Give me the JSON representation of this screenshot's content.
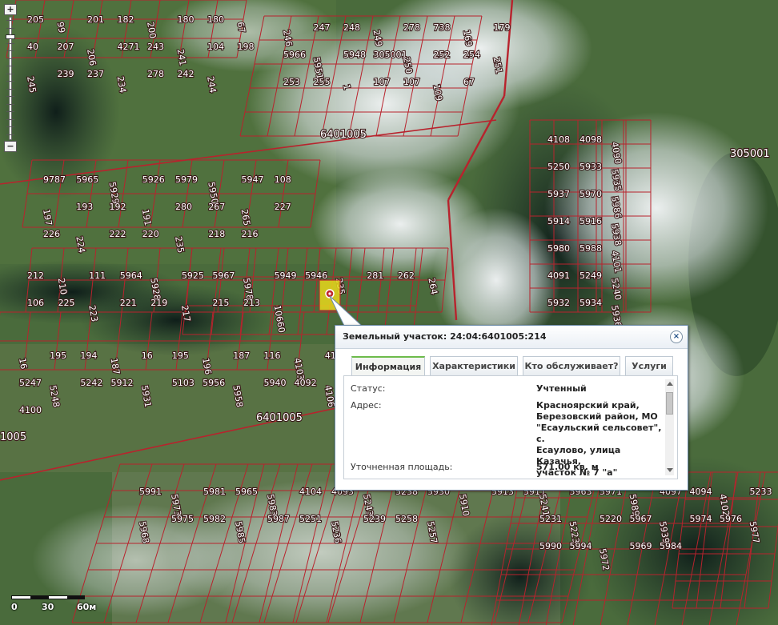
{
  "popup": {
    "title": "Земельный участок: 24:04:6401005:214",
    "close_glyph": "×",
    "tabs": [
      {
        "label": "Информация",
        "active": true
      },
      {
        "label": "Характеристики",
        "active": false
      },
      {
        "label": "Кто обслуживает?",
        "active": false
      },
      {
        "label": "Услуги",
        "active": false
      }
    ],
    "info": {
      "status_label": "Статус:",
      "status_value": "Учтенный",
      "address_label": "Адрес:",
      "address_lines": [
        "Красноярский край,",
        "Березовский район, МО",
        "\"Есаульский сельсовет\", с.",
        "Есаулово, улица Казачья,",
        "участок № 7 \"а\""
      ],
      "area_label": "Уточненная площадь:",
      "area_value": "571.00 кв. м"
    }
  },
  "zoom": {
    "plus": "+",
    "minus": "−",
    "level_fraction": 0.15
  },
  "scale": {
    "labels": [
      "0",
      "30",
      "60м"
    ]
  },
  "map": {
    "block_labels": [
      "6401005",
      "6401005",
      "305001",
      "1005"
    ],
    "plot_labels": [
      "205",
      "99",
      "201",
      "182",
      "200",
      "180",
      "180",
      "67",
      "40",
      "207",
      "206",
      "4271",
      "243",
      "241",
      "104",
      "198",
      "245",
      "239",
      "237",
      "234",
      "278",
      "242",
      "244",
      "246",
      "247",
      "248",
      "249",
      "278",
      "738",
      "169",
      "179",
      "5966",
      "5951",
      "5948",
      "305001",
      "250",
      "252",
      "254",
      "251",
      "253",
      "255",
      "1",
      "107",
      "107",
      "109",
      "67",
      "9787",
      "5965",
      "5929",
      "5926",
      "5979",
      "5950",
      "5947",
      "108",
      "197",
      "193",
      "192",
      "191",
      "280",
      "267",
      "265",
      "227",
      "226",
      "224",
      "222",
      "220",
      "235",
      "218",
      "216",
      "212",
      "210",
      "111",
      "5964",
      "5928",
      "5925",
      "5967",
      "5978",
      "5949",
      "5946",
      "235",
      "281",
      "262",
      "264",
      "106",
      "225",
      "223",
      "221",
      "219",
      "217",
      "215",
      "213",
      "10660",
      "16",
      "195",
      "194",
      "187",
      "16",
      "195",
      "196",
      "187",
      "116",
      "4103",
      "4109",
      "5247",
      "5248",
      "5242",
      "5912",
      "5931",
      "5103",
      "5956",
      "5958",
      "5940",
      "4092",
      "4106",
      "4100",
      "4108",
      "4098",
      "4090",
      "5250",
      "5933",
      "5935",
      "5937",
      "5970",
      "5986",
      "5914",
      "5916",
      "5938",
      "5980",
      "5988",
      "4101",
      "4091",
      "5249",
      "5240",
      "5932",
      "5934",
      "5936",
      "5991",
      "5973",
      "5981",
      "5965",
      "5983",
      "4104",
      "4093",
      "5243",
      "5238",
      "5930",
      "5910",
      "5913",
      "5911",
      "5968",
      "5975",
      "5982",
      "5985",
      "5987",
      "5251",
      "5236",
      "5239",
      "5258",
      "5257",
      "5241",
      "5963",
      "5971",
      "5989",
      "4097",
      "4094",
      "4102",
      "5233",
      "5231",
      "5223",
      "5220",
      "5967",
      "5939",
      "5974",
      "5976",
      "5977",
      "5990",
      "5994",
      "5972",
      "5969",
      "5984"
    ]
  },
  "colors": {
    "parcel_line": "#b8232d",
    "selected_fill": "#e8d81c",
    "popup_border": "#6a8aa8",
    "tab_active_accent": "#6dbb4b",
    "close_icon": "#1f4f86"
  }
}
